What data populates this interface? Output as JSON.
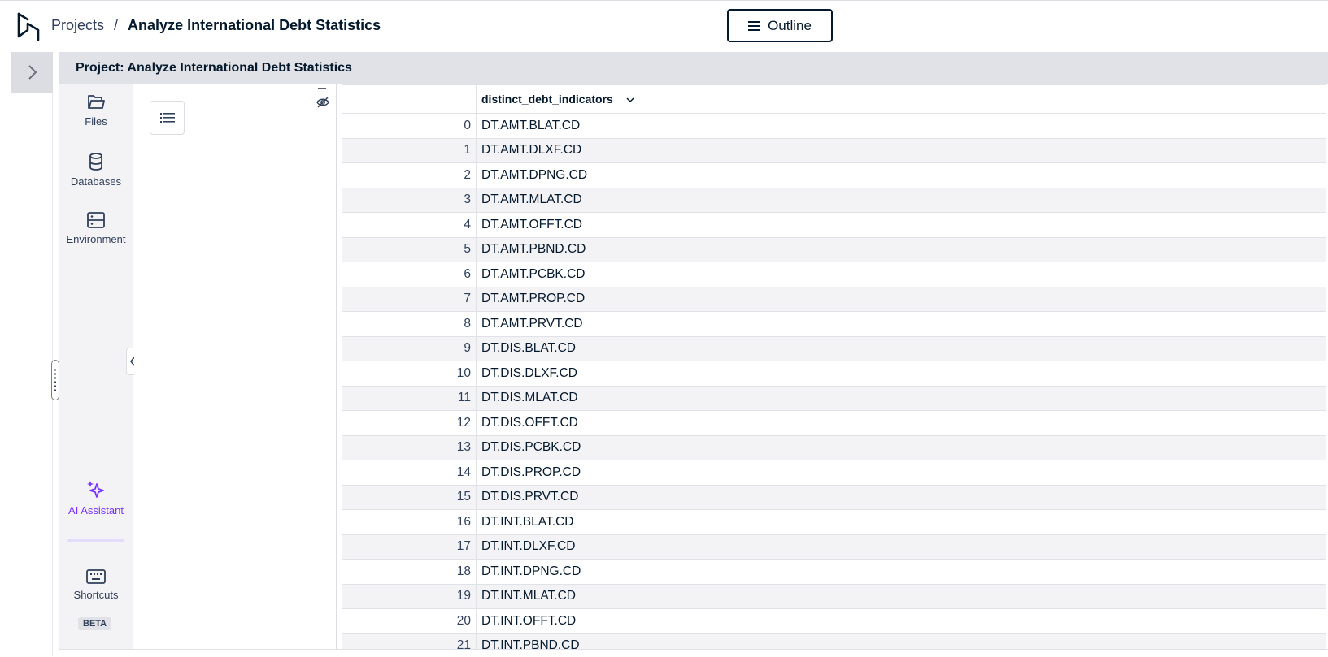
{
  "breadcrumb": {
    "root": "Projects",
    "separator": "/",
    "current": "Analyze International Debt Statistics"
  },
  "topbar": {
    "outline_label": "Outline",
    "outline_icon": "menu-icon"
  },
  "project_header": {
    "title": "Project: Analyze International Debt Statistics"
  },
  "side_nav": {
    "files": "Files",
    "databases": "Databases",
    "environment": "Environment",
    "ai_assistant": "AI Assistant",
    "shortcuts": "Shortcuts",
    "beta": "BETA"
  },
  "colors": {
    "ai_accent": "#7933ff",
    "primary_text": "#05192d",
    "header_bg": "#e1e2e7"
  },
  "table": {
    "column": "distinct_debt_indicators",
    "rows": [
      {
        "index": "0",
        "value": "DT.AMT.BLAT.CD"
      },
      {
        "index": "1",
        "value": "DT.AMT.DLXF.CD"
      },
      {
        "index": "2",
        "value": "DT.AMT.DPNG.CD"
      },
      {
        "index": "3",
        "value": "DT.AMT.MLAT.CD"
      },
      {
        "index": "4",
        "value": "DT.AMT.OFFT.CD"
      },
      {
        "index": "5",
        "value": "DT.AMT.PBND.CD"
      },
      {
        "index": "6",
        "value": "DT.AMT.PCBK.CD"
      },
      {
        "index": "7",
        "value": "DT.AMT.PROP.CD"
      },
      {
        "index": "8",
        "value": "DT.AMT.PRVT.CD"
      },
      {
        "index": "9",
        "value": "DT.DIS.BLAT.CD"
      },
      {
        "index": "10",
        "value": "DT.DIS.DLXF.CD"
      },
      {
        "index": "11",
        "value": "DT.DIS.MLAT.CD"
      },
      {
        "index": "12",
        "value": "DT.DIS.OFFT.CD"
      },
      {
        "index": "13",
        "value": "DT.DIS.PCBK.CD"
      },
      {
        "index": "14",
        "value": "DT.DIS.PROP.CD"
      },
      {
        "index": "15",
        "value": "DT.DIS.PRVT.CD"
      },
      {
        "index": "16",
        "value": "DT.INT.BLAT.CD"
      },
      {
        "index": "17",
        "value": "DT.INT.DLXF.CD"
      },
      {
        "index": "18",
        "value": "DT.INT.DPNG.CD"
      },
      {
        "index": "19",
        "value": "DT.INT.MLAT.CD"
      },
      {
        "index": "20",
        "value": "DT.INT.OFFT.CD"
      },
      {
        "index": "21",
        "value": "DT.INT.PBND.CD"
      }
    ]
  }
}
